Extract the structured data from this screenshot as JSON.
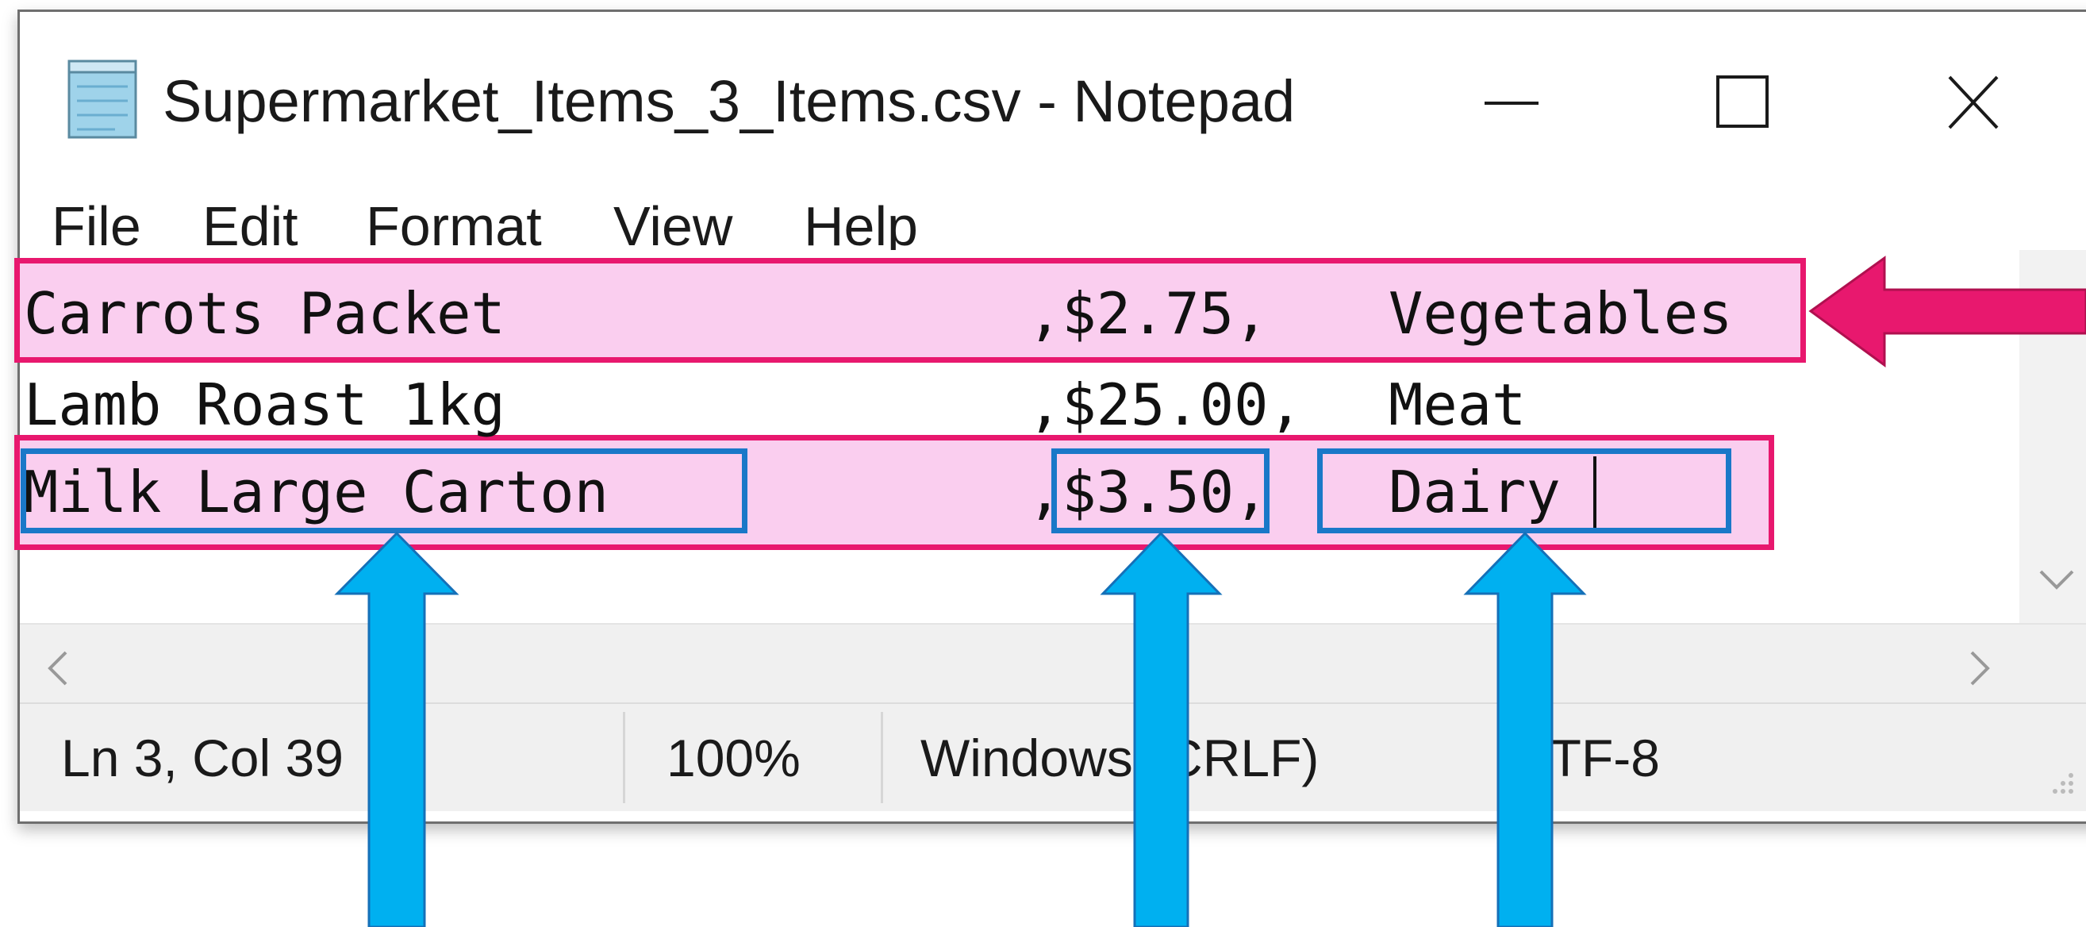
{
  "window": {
    "title": "Supermarket_Items_3_Items.csv - Notepad",
    "minimize_symbol": "—",
    "maximize_symbol": "☐",
    "close_symbol": "✕"
  },
  "menu": [
    "File",
    "Edit",
    "Format",
    "View",
    "Help"
  ],
  "lines": [
    {
      "name": "Carrots Packet",
      "price": ",$2.75,",
      "category": "Vegetables",
      "separator": "  "
    },
    {
      "name": "Lamb Roast 1kg",
      "price": ",$25.00,",
      "category": "Meat",
      "separator": " "
    },
    {
      "name": "Milk Large Carton",
      "price": ",$3.50,",
      "category": "Dairy",
      "separator": "  "
    }
  ],
  "status": {
    "position": "Ln 3, Col 39",
    "zoom": "100%",
    "line_ending": "Windows (CRLF)",
    "encoding": "UTF-8"
  },
  "colors": {
    "row_highlight_fill": "#f7b4e6",
    "row_highlight_border": "#e8186e",
    "field_box_border": "#1a78c8",
    "callout_arrow_pink": "#e8186e",
    "callout_arrow_blue": "#00b0f0"
  },
  "icons": {
    "app": "notepad-icon",
    "minimize": "minimize-icon",
    "maximize": "maximize-icon",
    "close": "close-icon",
    "scroll_left": "chevron-left-icon",
    "scroll_right": "chevron-right-icon",
    "scroll_down": "chevron-down-icon",
    "resize": "resize-grip-icon"
  }
}
